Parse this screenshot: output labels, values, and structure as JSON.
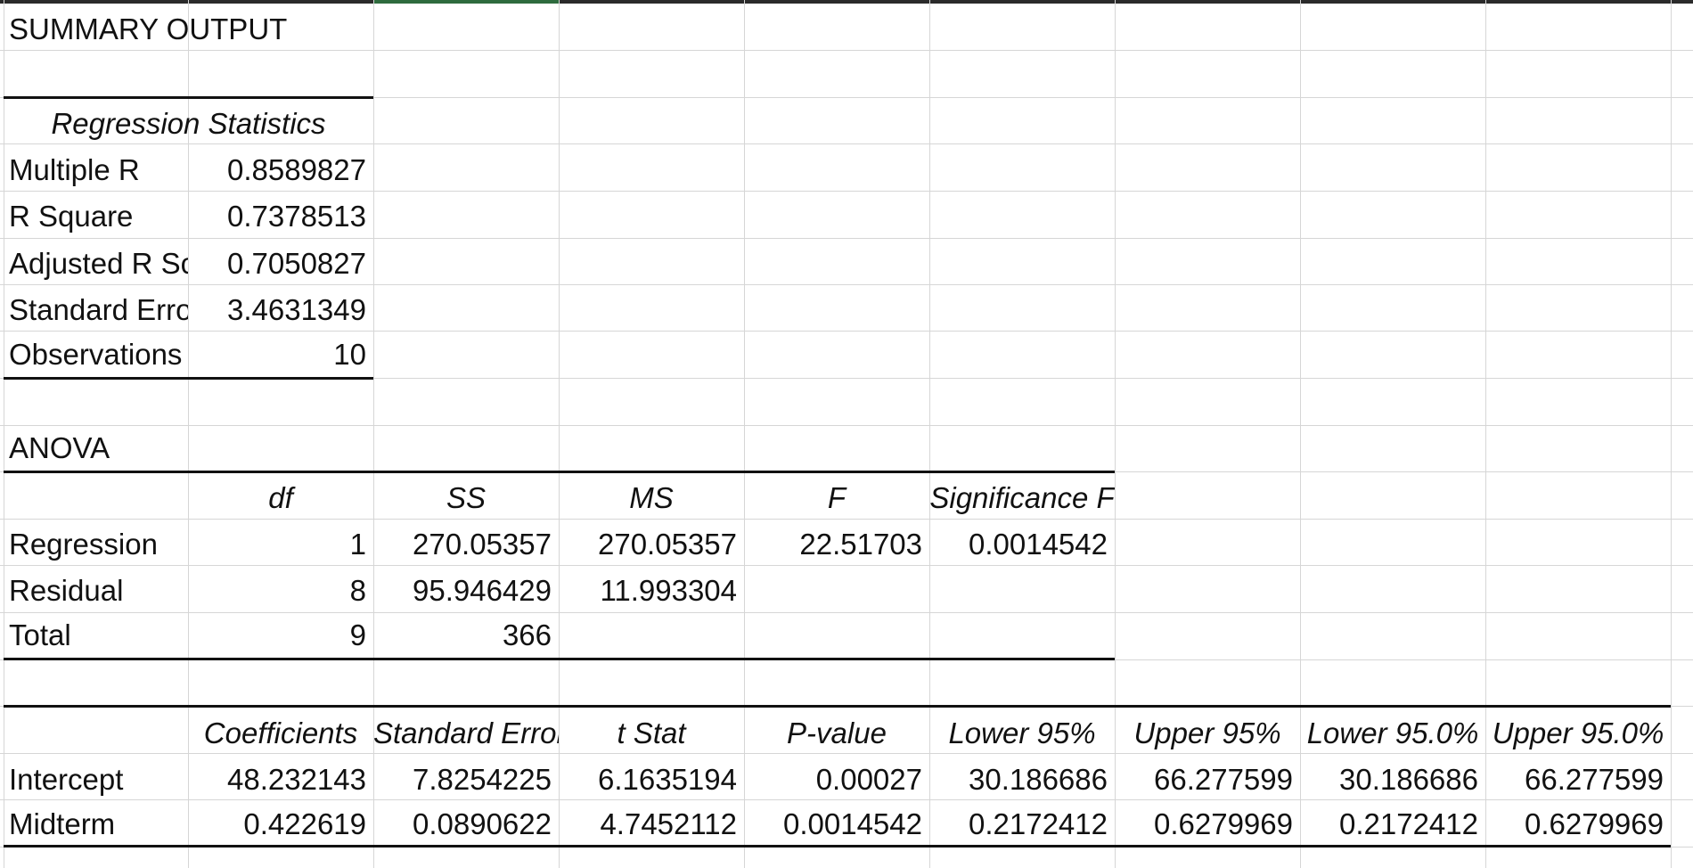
{
  "title": "SUMMARY OUTPUT",
  "regression_statistics": {
    "header": "Regression Statistics",
    "rows": [
      {
        "label": "Multiple R",
        "value": "0.8589827"
      },
      {
        "label": "R Square",
        "value": "0.7378513"
      },
      {
        "label": "Adjusted R Sc",
        "value": "0.7050827"
      },
      {
        "label": "Standard Erro",
        "value": "3.4631349"
      },
      {
        "label": "Observations",
        "value": "10"
      }
    ]
  },
  "anova": {
    "title": "ANOVA",
    "headers": [
      "df",
      "SS",
      "MS",
      "F",
      "Significance F"
    ],
    "rows": [
      {
        "label": "Regression",
        "values": [
          "1",
          "270.05357",
          "270.05357",
          "22.51703",
          "0.0014542"
        ]
      },
      {
        "label": "Residual",
        "values": [
          "8",
          "95.946429",
          "11.993304",
          "",
          ""
        ]
      },
      {
        "label": "Total",
        "values": [
          "9",
          "366",
          "",
          "",
          ""
        ]
      }
    ]
  },
  "coefficients": {
    "headers": [
      "Coefficients",
      "Standard Error",
      "t Stat",
      "P-value",
      "Lower 95%",
      "Upper 95%",
      "Lower 95.0%",
      "Upper 95.0%"
    ],
    "rows": [
      {
        "label": "Intercept",
        "values": [
          "48.232143",
          "7.8254225",
          "6.1635194",
          "0.00027",
          "30.186686",
          "66.277599",
          "30.186686",
          "66.277599"
        ]
      },
      {
        "label": "Midterm",
        "values": [
          "0.422619",
          "0.0890622",
          "4.7452112",
          "0.0014542",
          "0.2172412",
          "0.6279969",
          "0.2172412",
          "0.6279969"
        ]
      }
    ]
  }
}
